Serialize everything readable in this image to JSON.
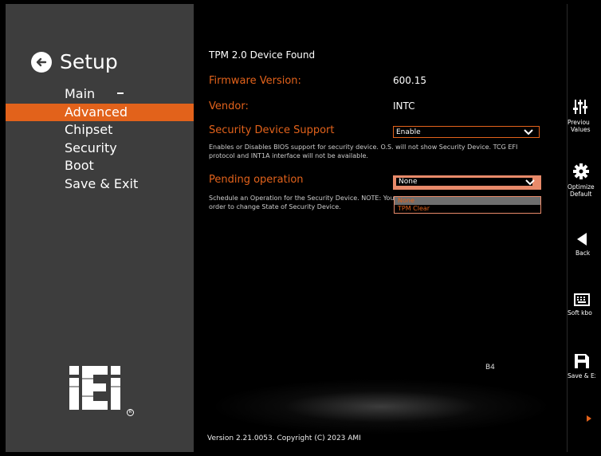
{
  "setup": {
    "title": "Setup"
  },
  "menu": {
    "items": [
      {
        "label": "Main"
      },
      {
        "label": "Advanced"
      },
      {
        "label": "Chipset"
      },
      {
        "label": "Security"
      },
      {
        "label": "Boot"
      },
      {
        "label": "Save & Exit"
      }
    ],
    "active": "Advanced"
  },
  "content": {
    "header": "TPM 2.0 Device Found",
    "firmware_label": "Firmware Version:",
    "firmware_value": "600.15",
    "vendor_label": "Vendor:",
    "vendor_value": "INTC",
    "security_support_label": "Security Device Support",
    "security_support_value": "Enable",
    "security_help_line1": "Enables or Disables BIOS support for security device. O.S. will not show Security Device. TCG EFI",
    "security_help_line2": "protocol and INT1A interface will not be available.",
    "pending_label": "Pending operation",
    "pending_value": "None",
    "pending_help_line1": "Schedule an Operation for the Security Device. NOTE: You",
    "pending_help_line2": "order to change State of Security Device.",
    "pending_options": [
      "None",
      "TPM Clear"
    ],
    "code": "B4",
    "version": "Version 2.21.0053. Copyright (C) 2023 AMI"
  },
  "toolbar": {
    "previous_line1": "Previou",
    "previous_line2": "Values",
    "optimized_line1": "Optimize",
    "optimized_line2": "Default",
    "back": "Back",
    "softkbd": "Soft kbo",
    "save_exit": "Save & Ex"
  },
  "colors": {
    "accent": "#e2621b",
    "panel": "#3d3d3d",
    "background": "#000000"
  }
}
